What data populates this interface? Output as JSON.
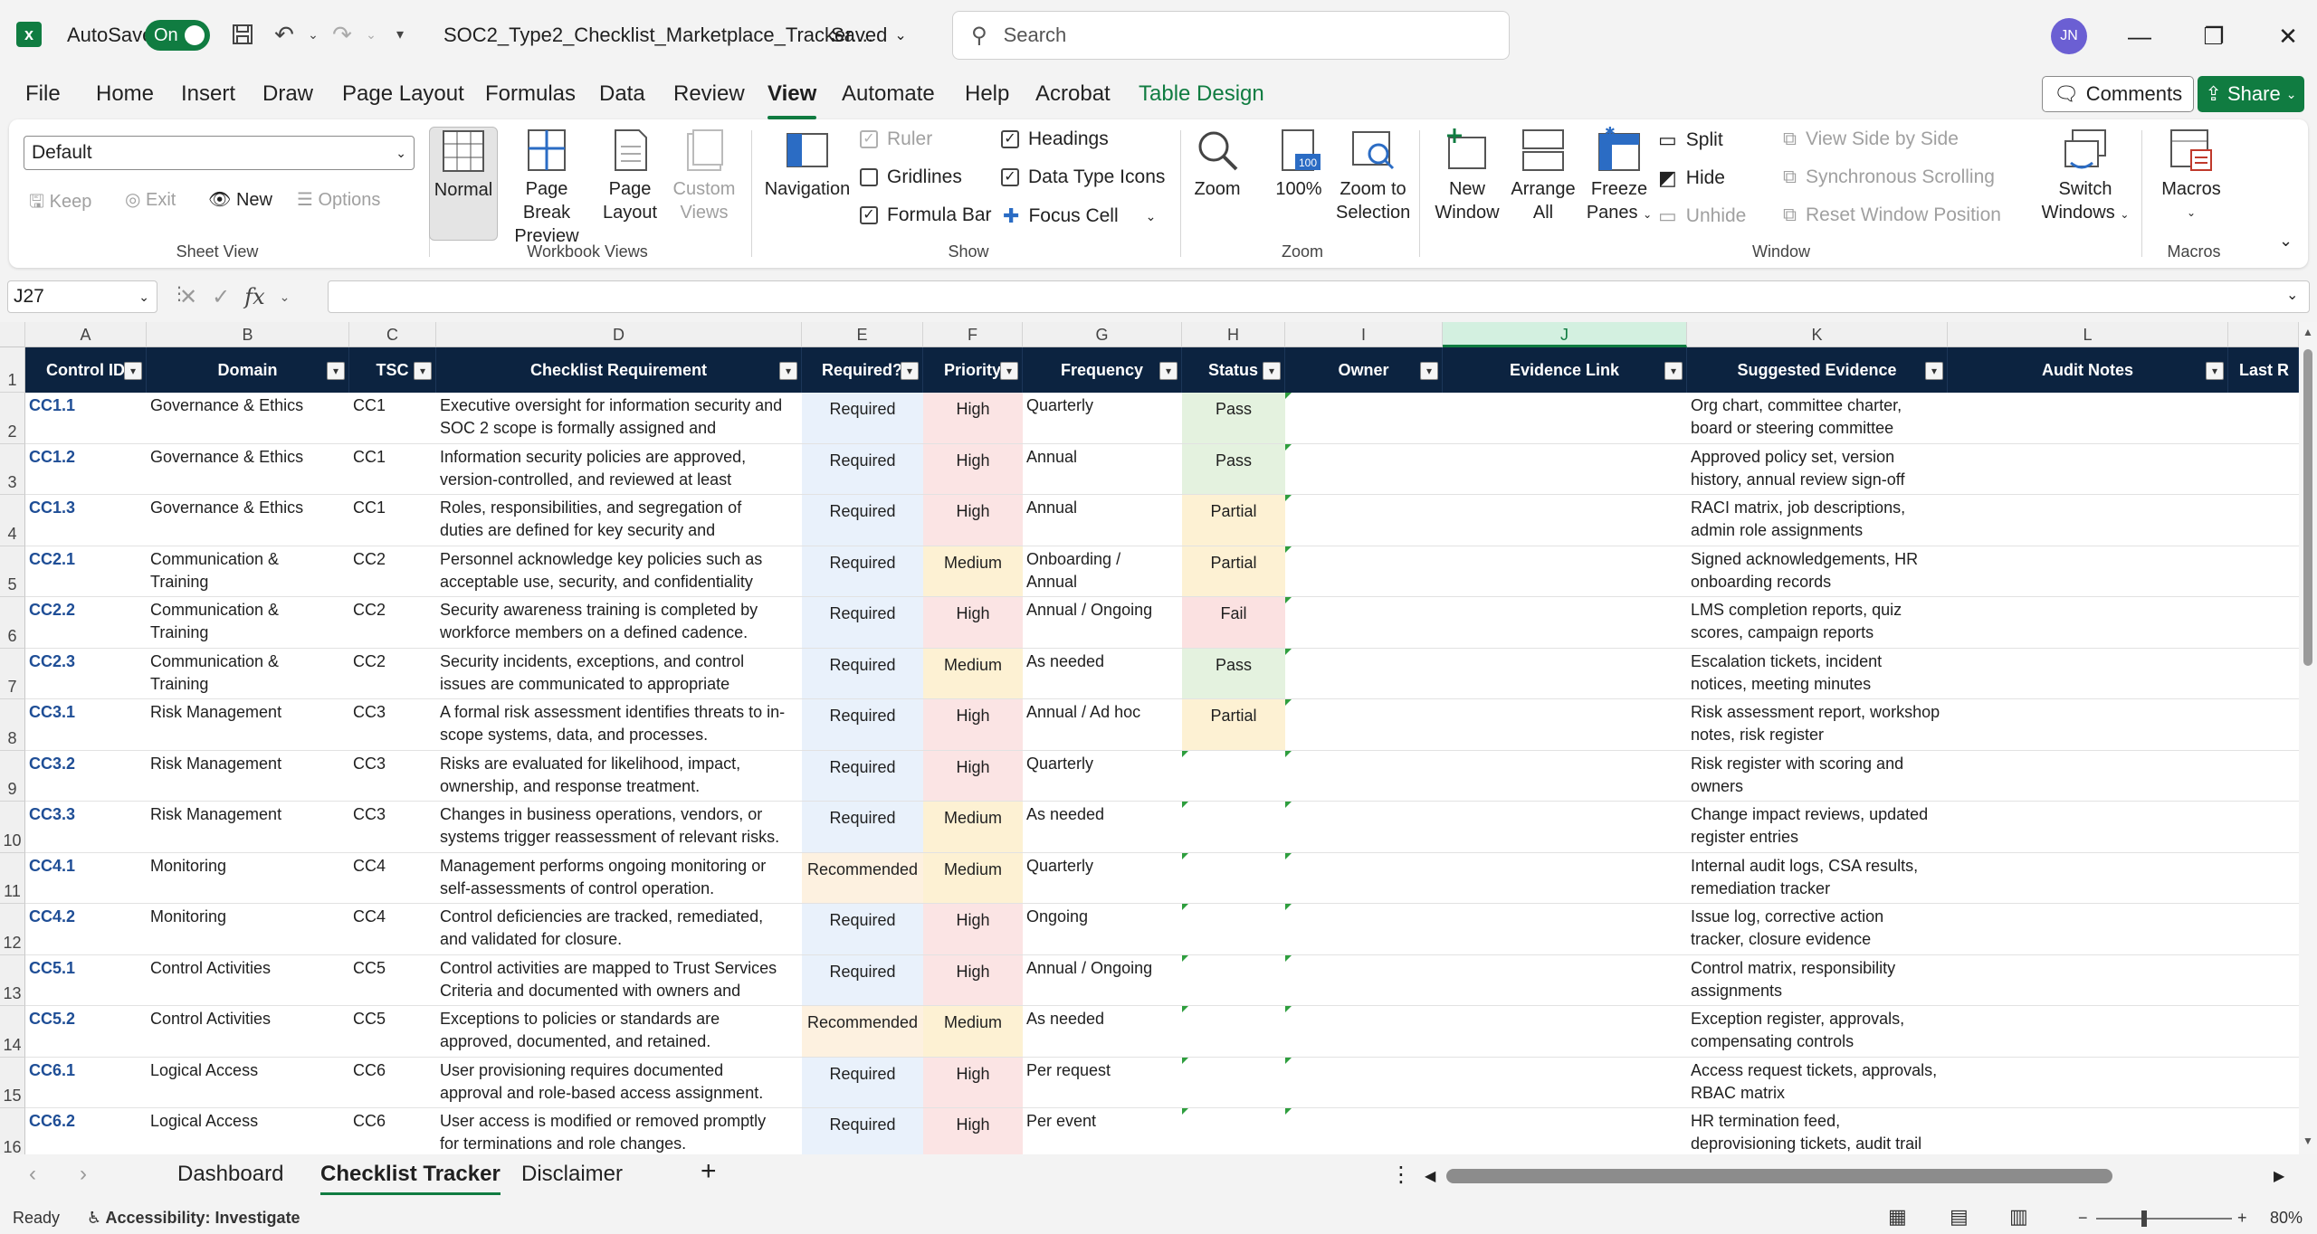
{
  "titlebar": {
    "autosave_label": "AutoSave",
    "autosave_state": "On",
    "filename": "SOC2_Type2_Checklist_Marketplace_Tracker....",
    "saved_status": "Saved",
    "search_placeholder": "Search",
    "user_initials": "JN"
  },
  "ribbon_tabs": [
    "File",
    "Home",
    "Insert",
    "Draw",
    "Page Layout",
    "Formulas",
    "Data",
    "Review",
    "View",
    "Automate",
    "Help",
    "Acrobat",
    "Table Design"
  ],
  "active_tab": "View",
  "buttons": {
    "comments": "Comments",
    "share": "Share"
  },
  "ribbon": {
    "sheet_view": {
      "select_value": "Default",
      "keep": "Keep",
      "exit": "Exit",
      "new": "New",
      "options": "Options",
      "label": "Sheet View"
    },
    "workbook_views": {
      "normal": "Normal",
      "page_break_1": "Page Break",
      "page_break_2": "Preview",
      "page_layout_1": "Page",
      "page_layout_2": "Layout",
      "custom_1": "Custom",
      "custom_2": "Views",
      "label": "Workbook Views"
    },
    "show": {
      "navigation": "Navigation",
      "ruler": "Ruler",
      "gridlines": "Gridlines",
      "formula_bar": "Formula Bar",
      "headings": "Headings",
      "data_type_icons": "Data Type Icons",
      "focus_cell": "Focus Cell",
      "label": "Show"
    },
    "zoom": {
      "zoom": "Zoom",
      "hundred": "100%",
      "zoom_sel_1": "Zoom to",
      "zoom_sel_2": "Selection",
      "label": "Zoom"
    },
    "window": {
      "new_1": "New",
      "new_2": "Window",
      "arrange_1": "Arrange",
      "arrange_2": "All",
      "freeze_1": "Freeze",
      "freeze_2": "Panes",
      "split": "Split",
      "hide": "Hide",
      "unhide": "Unhide",
      "side_by_side": "View Side by Side",
      "sync_scroll": "Synchronous Scrolling",
      "reset_pos": "Reset Window Position",
      "switch_1": "Switch",
      "switch_2": "Windows",
      "label": "Window"
    },
    "macros": {
      "macros": "Macros",
      "label": "Macros"
    }
  },
  "formula_bar": {
    "namebox": "J27",
    "fx": "fx",
    "value": ""
  },
  "columns": [
    "A",
    "B",
    "C",
    "D",
    "E",
    "F",
    "G",
    "H",
    "I",
    "J",
    "K",
    "L"
  ],
  "table_headers": [
    "Control ID",
    "Domain",
    "TSC",
    "Checklist Requirement",
    "Required?",
    "Priority",
    "Frequency",
    "Status",
    "Owner",
    "Evidence Link",
    "Suggested Evidence",
    "Audit Notes",
    "Last R"
  ],
  "rows": [
    {
      "num": "2",
      "id": "CC1.1",
      "domain": "Governance & Ethics",
      "tsc": "CC1",
      "req": [
        "Executive oversight for information security and",
        "SOC 2 scope is formally assigned and"
      ],
      "required": "Required",
      "priority": "High",
      "freq": [
        "Quarterly",
        ""
      ],
      "status": "Pass",
      "evidence": [
        "Org chart, committee charter,",
        "board or steering committee"
      ]
    },
    {
      "num": "3",
      "id": "CC1.2",
      "domain": "Governance & Ethics",
      "tsc": "CC1",
      "req": [
        "Information security policies are approved,",
        "version-controlled, and reviewed at least"
      ],
      "required": "Required",
      "priority": "High",
      "freq": [
        "Annual",
        ""
      ],
      "status": "Pass",
      "evidence": [
        "Approved policy set, version",
        "history, annual review sign-off"
      ]
    },
    {
      "num": "4",
      "id": "CC1.3",
      "domain": "Governance & Ethics",
      "tsc": "CC1",
      "req": [
        "Roles, responsibilities, and segregation of",
        "duties are defined for key security and"
      ],
      "required": "Required",
      "priority": "High",
      "freq": [
        "Annual",
        ""
      ],
      "status": "Partial",
      "evidence": [
        "RACI matrix, job descriptions,",
        "admin role assignments"
      ]
    },
    {
      "num": "5",
      "id": "CC2.1",
      "domain": "Communication &\nTraining",
      "tsc": "CC2",
      "req": [
        "Personnel acknowledge key policies such as",
        "acceptable use, security, and confidentiality"
      ],
      "required": "Required",
      "priority": "Medium",
      "freq": [
        "Onboarding /",
        "Annual"
      ],
      "status": "Partial",
      "evidence": [
        "Signed acknowledgements, HR",
        "onboarding records"
      ]
    },
    {
      "num": "6",
      "id": "CC2.2",
      "domain": "Communication &\nTraining",
      "tsc": "CC2",
      "req": [
        "Security awareness training is completed by",
        "workforce members on a defined cadence."
      ],
      "required": "Required",
      "priority": "High",
      "freq": [
        "Annual / Ongoing",
        ""
      ],
      "status": "Fail",
      "evidence": [
        "LMS completion reports, quiz",
        "scores, campaign reports"
      ]
    },
    {
      "num": "7",
      "id": "CC2.3",
      "domain": "Communication &\nTraining",
      "tsc": "CC2",
      "req": [
        "Security incidents, exceptions, and control",
        "issues are communicated to appropriate"
      ],
      "required": "Required",
      "priority": "Medium",
      "freq": [
        "As needed",
        ""
      ],
      "status": "Pass",
      "evidence": [
        "Escalation tickets, incident",
        "notices, meeting minutes"
      ]
    },
    {
      "num": "8",
      "id": "CC3.1",
      "domain": "Risk Management",
      "tsc": "CC3",
      "req": [
        "A formal risk assessment identifies threats to in-",
        "scope systems, data, and processes."
      ],
      "required": "Required",
      "priority": "High",
      "freq": [
        "Annual / Ad hoc",
        ""
      ],
      "status": "Partial",
      "evidence": [
        "Risk assessment report, workshop",
        "notes, risk register"
      ]
    },
    {
      "num": "9",
      "id": "CC3.2",
      "domain": "Risk Management",
      "tsc": "CC3",
      "req": [
        "Risks are evaluated for likelihood, impact,",
        "ownership, and response treatment."
      ],
      "required": "Required",
      "priority": "High",
      "freq": [
        "Quarterly",
        ""
      ],
      "status": "",
      "evidence": [
        "Risk register with scoring and",
        "owners"
      ]
    },
    {
      "num": "10",
      "id": "CC3.3",
      "domain": "Risk Management",
      "tsc": "CC3",
      "req": [
        "Changes in business operations, vendors, or",
        "systems trigger reassessment of relevant risks."
      ],
      "required": "Required",
      "priority": "Medium",
      "freq": [
        "As needed",
        ""
      ],
      "status": "",
      "evidence": [
        "Change impact reviews, updated",
        "register entries"
      ]
    },
    {
      "num": "11",
      "id": "CC4.1",
      "domain": "Monitoring",
      "tsc": "CC4",
      "req": [
        "Management performs ongoing monitoring or",
        "self-assessments of control operation."
      ],
      "required": "Recommended",
      "priority": "Medium",
      "freq": [
        "Quarterly",
        ""
      ],
      "status": "",
      "evidence": [
        "Internal audit logs, CSA results,",
        "remediation tracker"
      ]
    },
    {
      "num": "12",
      "id": "CC4.2",
      "domain": "Monitoring",
      "tsc": "CC4",
      "req": [
        "Control deficiencies are tracked, remediated,",
        "and validated for closure."
      ],
      "required": "Required",
      "priority": "High",
      "freq": [
        "Ongoing",
        ""
      ],
      "status": "",
      "evidence": [
        "Issue log, corrective action",
        "tracker, closure evidence"
      ]
    },
    {
      "num": "13",
      "id": "CC5.1",
      "domain": "Control Activities",
      "tsc": "CC5",
      "req": [
        "Control activities are mapped to Trust Services",
        "Criteria and documented with owners and"
      ],
      "required": "Required",
      "priority": "High",
      "freq": [
        "Annual / Ongoing",
        ""
      ],
      "status": "",
      "evidence": [
        "Control matrix, responsibility",
        "assignments"
      ]
    },
    {
      "num": "14",
      "id": "CC5.2",
      "domain": "Control Activities",
      "tsc": "CC5",
      "req": [
        "Exceptions to policies or standards are",
        "approved, documented, and retained."
      ],
      "required": "Recommended",
      "priority": "Medium",
      "freq": [
        "As needed",
        ""
      ],
      "status": "",
      "evidence": [
        "Exception register, approvals,",
        "compensating controls"
      ]
    },
    {
      "num": "15",
      "id": "CC6.1",
      "domain": "Logical Access",
      "tsc": "CC6",
      "req": [
        "User provisioning requires documented",
        "approval and role-based access assignment."
      ],
      "required": "Required",
      "priority": "High",
      "freq": [
        "Per request",
        ""
      ],
      "status": "",
      "evidence": [
        "Access request tickets, approvals,",
        "RBAC matrix"
      ]
    },
    {
      "num": "16",
      "id": "CC6.2",
      "domain": "Logical Access",
      "tsc": "CC6",
      "req": [
        "User access is modified or removed promptly",
        "for terminations and role changes."
      ],
      "required": "Required",
      "priority": "High",
      "freq": [
        "Per event",
        ""
      ],
      "status": "",
      "evidence": [
        "HR termination feed,",
        "deprovisioning tickets, audit trail"
      ]
    }
  ],
  "row1_num": "1",
  "sheet_tabs": [
    "Dashboard",
    "Checklist Tracker",
    "Disclaimer"
  ],
  "active_sheet": "Checklist Tracker",
  "statusbar": {
    "ready": "Ready",
    "accessibility": "Accessibility: Investigate",
    "zoom": "80%"
  },
  "colors": {
    "header_bg": "#0c2340",
    "required_bg": "#e9f1fb",
    "recommended_bg": "#fdf1e0",
    "high_bg": "#fbe4e4",
    "medium_bg": "#fdf1d3",
    "pass_bg": "#e4f2df",
    "partial_bg": "#fdf1d3",
    "fail_bg": "#fbe1e1",
    "accent": "#107c41"
  }
}
